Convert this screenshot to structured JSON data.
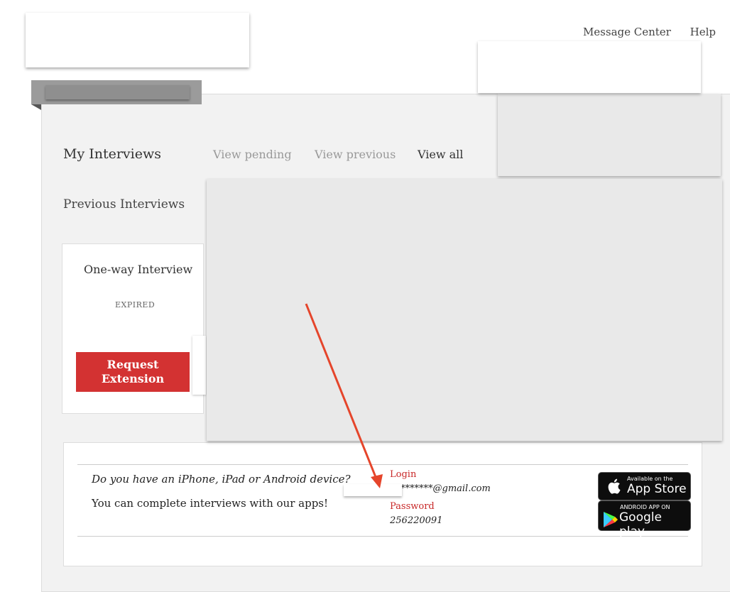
{
  "nav": {
    "message_center": "Message Center",
    "help": "Help"
  },
  "interviews": {
    "heading": "My Interviews",
    "tabs": [
      "View pending",
      "View previous",
      "View all"
    ],
    "active_tab": "View all",
    "section": "Previous Interviews",
    "card": {
      "title": "One-way Interview",
      "status": "EXPIRED",
      "button_line1": "Request",
      "button_line2": "Extension"
    }
  },
  "apps": {
    "question": "Do you have an iPhone, iPad or Android device?",
    "complete": "You can complete interviews with our apps!",
    "login_label": "Login",
    "login_value": "*******@gmail.com",
    "password_label": "Password",
    "password_value": "256220091",
    "appstore_small": "Available on the",
    "appstore_big": "App Store",
    "google_small": "ANDROID APP ON",
    "google_big": "Google play"
  },
  "colors": {
    "accent_red": "#d33232",
    "arrow": "#e5452b"
  }
}
